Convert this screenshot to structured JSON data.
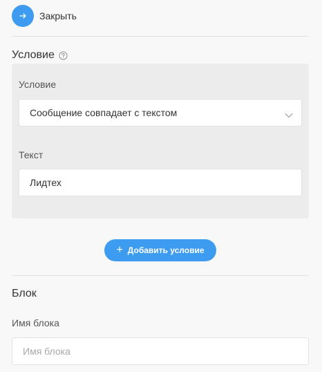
{
  "header": {
    "close_label": "Закрыть",
    "close_icon": "arrow-right-icon"
  },
  "condition": {
    "title": "Условие",
    "help_icon": "question-circle-icon",
    "type_label": "Условие",
    "type_value": "Сообщение совпадает с текстом",
    "text_label": "Текст",
    "text_value": "Лидтех"
  },
  "add_condition": {
    "label": "Добавить условие",
    "icon": "plus-icon"
  },
  "block": {
    "title": "Блок",
    "name_label": "Имя блока",
    "name_placeholder": "Имя блока",
    "name_value": ""
  },
  "colors": {
    "accent": "#3d9cf0",
    "background": "#f8f8f8",
    "panel": "#ececec"
  }
}
